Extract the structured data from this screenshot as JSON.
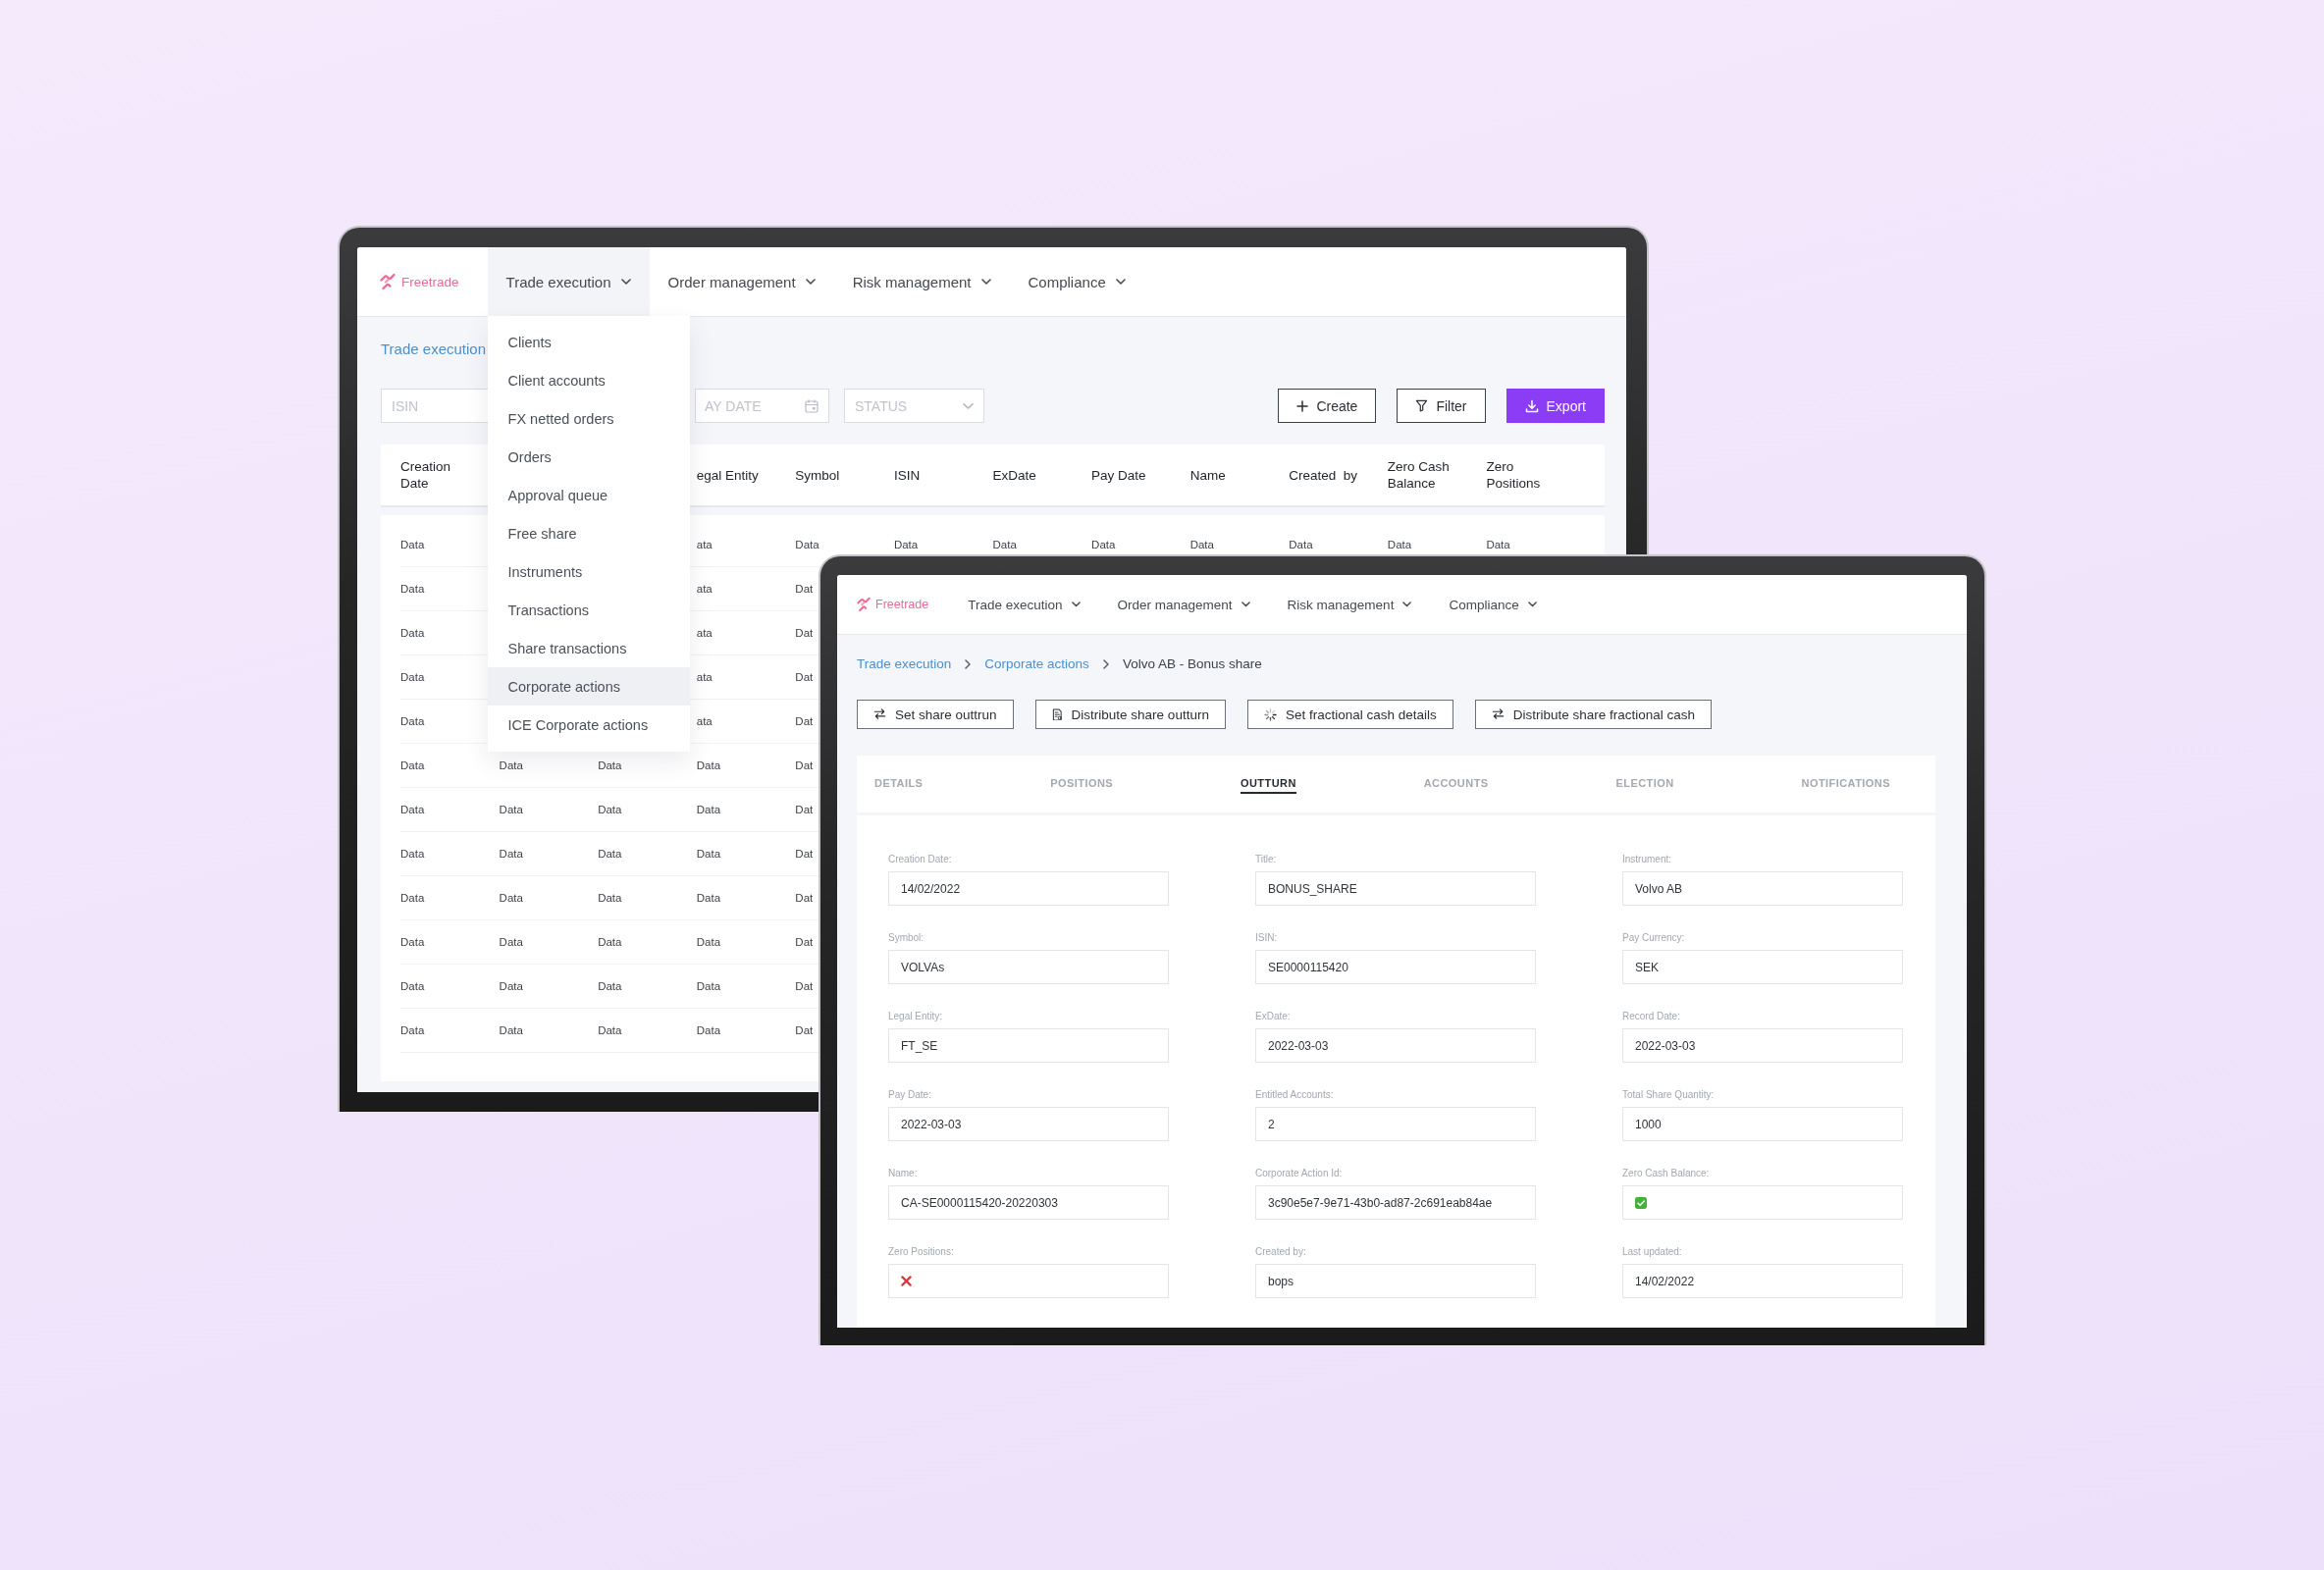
{
  "back_window": {
    "logo": {
      "text": "Freetrade"
    },
    "nav": [
      {
        "label": "Trade execution",
        "expanded": true,
        "menu": [
          {
            "label": "Clients",
            "selected": false
          },
          {
            "label": "Client accounts",
            "selected": false
          },
          {
            "label": "FX netted orders",
            "selected": false
          },
          {
            "label": "Orders",
            "selected": false
          },
          {
            "label": "Approval queue",
            "selected": false
          },
          {
            "label": "Free share",
            "selected": false
          },
          {
            "label": "Instruments",
            "selected": false
          },
          {
            "label": "Transactions",
            "selected": false
          },
          {
            "label": "Share transactions",
            "selected": false
          },
          {
            "label": "Corporate actions",
            "selected": true
          },
          {
            "label": "ICE Corporate actions",
            "selected": false
          }
        ]
      },
      {
        "label": "Order management",
        "expanded": false
      },
      {
        "label": "Risk management",
        "expanded": false
      },
      {
        "label": "Compliance",
        "expanded": false
      }
    ],
    "breadcrumb": [
      {
        "kind": "link",
        "label": "Trade execution"
      }
    ],
    "filters": [
      {
        "kind": "text",
        "placeholder": "ISIN"
      },
      {
        "kind": "date",
        "placeholder": "AY DATE"
      },
      {
        "kind": "select",
        "placeholder": "STATUS"
      }
    ],
    "actions": [
      {
        "kind": "create",
        "label": "Create"
      },
      {
        "kind": "filter",
        "label": "Filter"
      },
      {
        "kind": "export",
        "label": "Export"
      }
    ],
    "table": {
      "columns": [
        "Creation Date",
        null,
        null,
        "egal Entity",
        "Symbol",
        "ISIN",
        "ExDate",
        "Pay Date",
        "Name",
        "Created  by",
        "Zero Cash Balance",
        "Zero Positions"
      ],
      "rows": [
        [
          "Data",
          null,
          null,
          "ata",
          "Data",
          "Data",
          "Data",
          "Data",
          "Data",
          "Data",
          "Data",
          "Data"
        ],
        [
          "Data",
          null,
          null,
          "ata",
          "Dat"
        ],
        [
          "Data",
          null,
          null,
          "ata",
          "Dat"
        ],
        [
          "Data",
          null,
          null,
          "ata",
          "Dat"
        ],
        [
          "Data",
          null,
          null,
          "ata",
          "Dat"
        ],
        [
          "Data",
          "Data",
          "Data",
          "Data",
          "Dat"
        ],
        [
          "Data",
          "Data",
          "Data",
          "Data",
          "Dat"
        ],
        [
          "Data",
          "Data",
          "Data",
          "Data",
          "Dat"
        ],
        [
          "Data",
          "Data",
          "Data",
          "Data",
          "Dat"
        ],
        [
          "Data",
          "Data",
          "Data",
          "Data",
          "Dat"
        ],
        [
          "Data",
          "Data",
          "Data",
          "Data",
          "Dat"
        ],
        [
          "Data",
          "Data",
          "Data",
          "Data",
          "Dat"
        ]
      ]
    }
  },
  "front_window": {
    "logo": {
      "text": "Freetrade"
    },
    "nav": [
      {
        "label": "Trade execution",
        "expanded": false
      },
      {
        "label": "Order management",
        "expanded": false
      },
      {
        "label": "Risk management",
        "expanded": false
      },
      {
        "label": "Compliance",
        "expanded": false
      }
    ],
    "breadcrumb": [
      {
        "kind": "link",
        "label": "Trade execution"
      },
      {
        "kind": "link",
        "label": "Corporate actions"
      },
      {
        "kind": "current",
        "label": "Volvo AB - Bonus share"
      }
    ],
    "actions": [
      {
        "kind": "exchange",
        "label": "Set share outtrun"
      },
      {
        "kind": "document",
        "label": "Distribute share outturn"
      },
      {
        "kind": "progress",
        "label": "Set fractional cash details"
      },
      {
        "kind": "exchange",
        "label": "Distribute share fractional cash"
      }
    ],
    "tabs": [
      {
        "label": "DETAILS",
        "selected": false
      },
      {
        "label": "POSITIONS",
        "selected": false
      },
      {
        "label": "OUTTURN",
        "selected": true
      },
      {
        "label": "ACCOUNTS",
        "selected": false
      },
      {
        "label": "ELECTION",
        "selected": false
      },
      {
        "label": "NOTIFICATIONS",
        "selected": false
      }
    ],
    "fields": [
      {
        "kind": "text",
        "label": "Creation Date:",
        "value": "14/02/2022"
      },
      {
        "kind": "text",
        "label": "Title:",
        "value": "BONUS_SHARE"
      },
      {
        "kind": "text",
        "label": "Instrument:",
        "value": "Volvo AB"
      },
      {
        "kind": "text",
        "label": "Symbol:",
        "value": "VOLVAs"
      },
      {
        "kind": "text",
        "label": "ISIN:",
        "value": "SE0000115420"
      },
      {
        "kind": "text",
        "label": "Pay Currency:",
        "value": "SEK"
      },
      {
        "kind": "text",
        "label": "Legal Entity:",
        "value": "FT_SE"
      },
      {
        "kind": "text",
        "label": "ExDate:",
        "value": "2022-03-03"
      },
      {
        "kind": "text",
        "label": "Record Date:",
        "value": "2022-03-03"
      },
      {
        "kind": "text",
        "label": "Pay Date:",
        "value": "2022-03-03"
      },
      {
        "kind": "text",
        "label": "Entitled Accounts:",
        "value": "2"
      },
      {
        "kind": "text",
        "label": "Total Share Quantity:",
        "value": "1000"
      },
      {
        "kind": "text",
        "label": "Name:",
        "value": "CA-SE0000115420-20220303"
      },
      {
        "kind": "text",
        "label": "Corporate Action Id:",
        "value": "3c90e5e7-9e71-43b0-ad87-2c691eab84ae"
      },
      {
        "kind": "boolean",
        "label": "Zero Cash Balance:",
        "checked": true
      },
      {
        "kind": "boolean",
        "label": "Zero Positions:",
        "checked": false
      },
      {
        "kind": "text",
        "label": "Created by:",
        "value": "bops"
      },
      {
        "kind": "text",
        "label": "Last updated:",
        "value": "14/02/2022"
      }
    ]
  }
}
